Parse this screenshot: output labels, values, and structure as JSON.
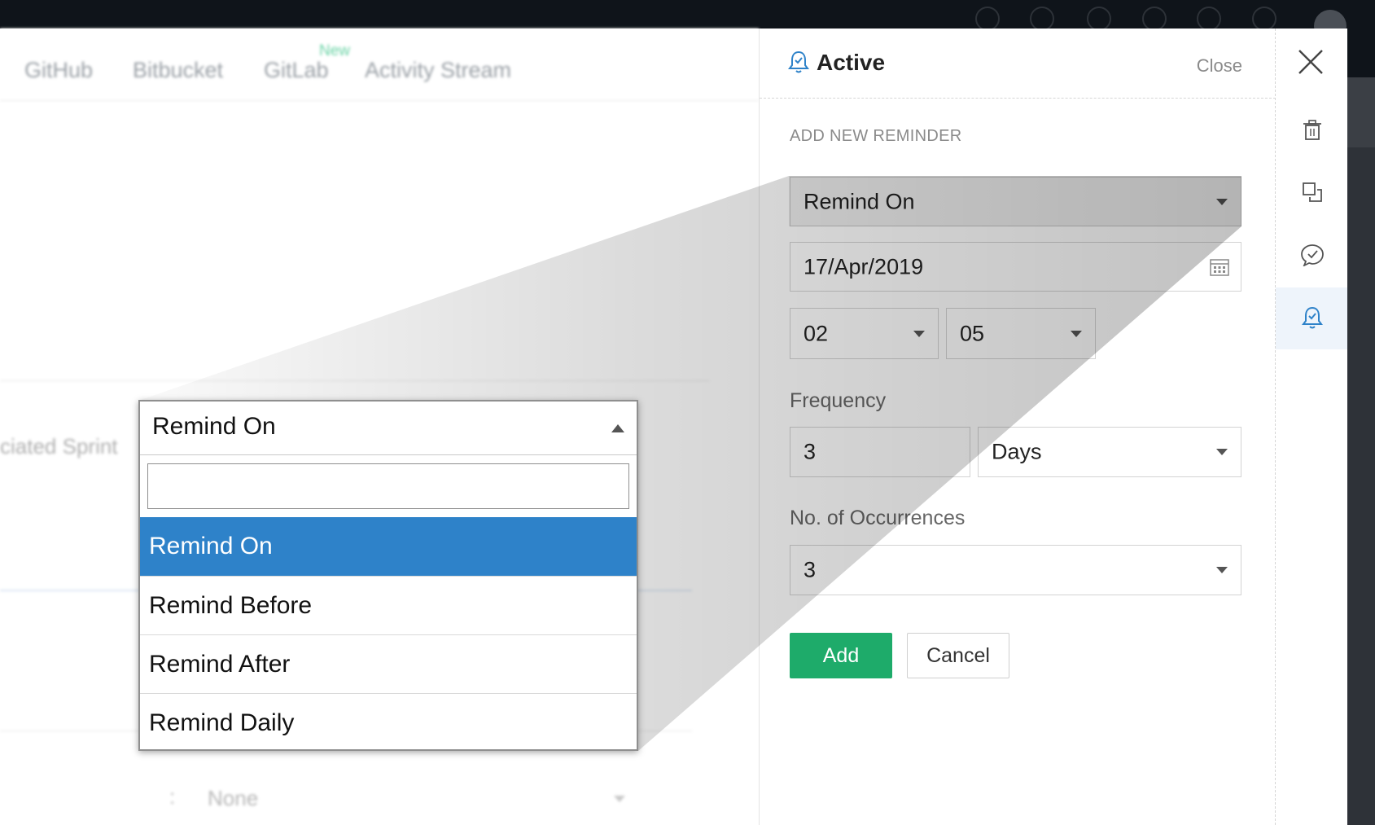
{
  "background_app": {
    "tabs": [
      "GitHub",
      "Bitbucket",
      "GitLab",
      "Activity Stream"
    ],
    "new_badge": "New",
    "sprint_label": "ciated Sprint",
    "colon": ":",
    "none_value": "None"
  },
  "panel": {
    "title": "Active",
    "close_label": "Close",
    "section_title": "ADD NEW REMINDER",
    "remind_type": "Remind On",
    "date": "17/Apr/2019",
    "hour": "02",
    "minute": "05",
    "frequency_label": "Frequency",
    "frequency_value": "3",
    "frequency_unit": "Days",
    "occurrences_label": "No. of Occurrences",
    "occurrences_value": "3",
    "add_label": "Add",
    "cancel_label": "Cancel"
  },
  "dropdown": {
    "selected": "Remind On",
    "search_value": "",
    "options": [
      "Remind On",
      "Remind Before",
      "Remind After",
      "Remind Daily"
    ],
    "highlighted_index": 0
  },
  "sidebar_icons": [
    "trash-icon",
    "copy-icon",
    "comment-check-icon",
    "reminder-bell-icon"
  ],
  "colors": {
    "accent_blue": "#2e82c9",
    "add_green": "#1eab6a",
    "topbar": "#0f141a"
  }
}
